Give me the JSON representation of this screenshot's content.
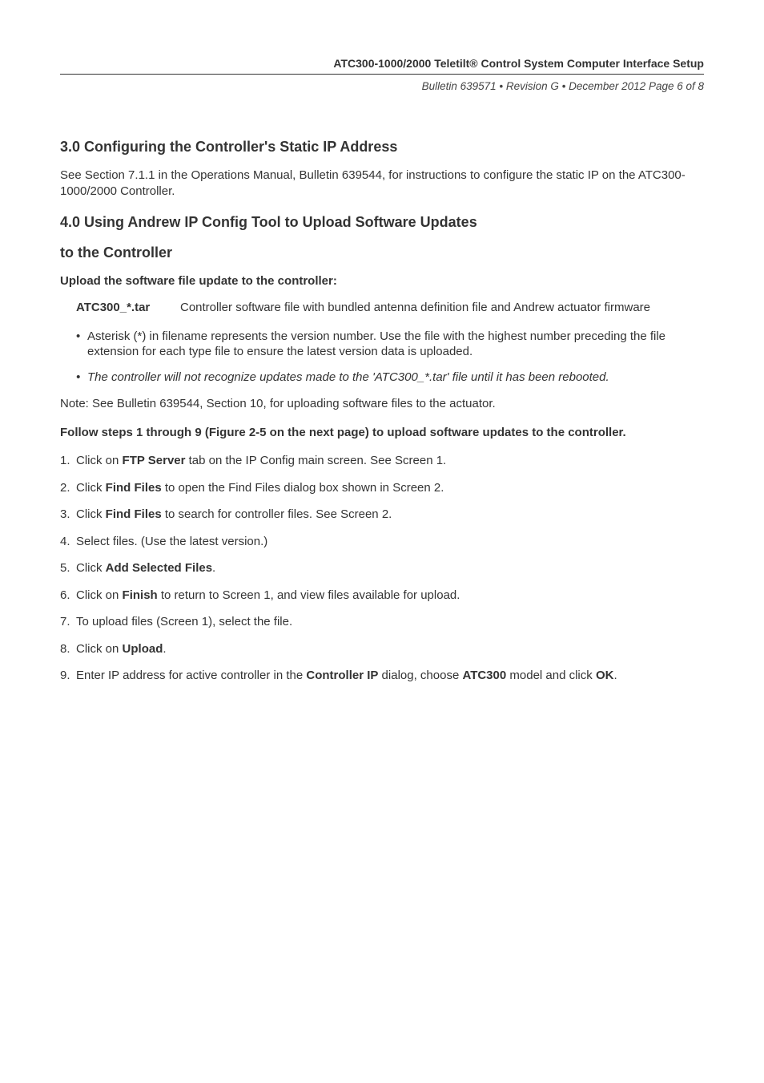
{
  "header": {
    "title": "ATC300-1000/2000 Teletilt® Control System Computer Interface Setup",
    "sub": "Bulletin 639571 • Revision G • December 2012 Page 6 of 8"
  },
  "section3": {
    "heading": "3.0 Configuring the Controller's Static IP Address",
    "body": "See Section 7.1.1 in the Operations Manual, Bulletin 639544, for instructions to configure the static IP on the ATC300-1000/2000 Controller."
  },
  "section4": {
    "heading_line1": "4.0 Using Andrew IP Config Tool to Upload Software Updates",
    "heading_line2": "to the Controller",
    "upload_sub": "Upload the software file update to the controller:",
    "def_term": "ATC300_*.tar",
    "def_desc": "Controller software file with bundled antenna definition file and Andrew actuator firmware",
    "bullet1": "Asterisk (*) in filename represents the version number. Use the file with the highest number preceding the file extension for each type file to ensure the latest version data is uploaded.",
    "bullet2": "The controller will not recognize updates made to the 'ATC300_*.tar' file until it has been rebooted.",
    "note": "Note: See Bulletin 639544, Section 10, for uploading software files to the actuator.",
    "steps_intro": "Follow steps 1 through 9 (Figure 2-5 on the next page) to upload software updates to the controller.",
    "steps": {
      "s1a": "Click on ",
      "s1b": "FTP Server",
      "s1c": " tab on the IP Config main screen. See Screen 1.",
      "s2a": "Click ",
      "s2b": "Find Files",
      "s2c": " to open the Find Files dialog box shown in Screen 2.",
      "s3a": "Click ",
      "s3b": "Find Files",
      "s3c": " to search for controller files. See Screen 2.",
      "s4": "Select files. (Use the latest version.)",
      "s5a": "Click ",
      "s5b": "Add Selected Files",
      "s5c": ".",
      "s6a": "Click on ",
      "s6b": "Finish",
      "s6c": " to return to Screen 1, and view files available for upload.",
      "s7": "To upload files (Screen 1), select the file.",
      "s8a": "Click on ",
      "s8b": "Upload",
      "s8c": ".",
      "s9a": "Enter IP address for active controller in the ",
      "s9b": "Controller IP",
      "s9c": " dialog, choose ",
      "s9d": "ATC300",
      "s9e": " model and click ",
      "s9f": "OK",
      "s9g": "."
    }
  }
}
